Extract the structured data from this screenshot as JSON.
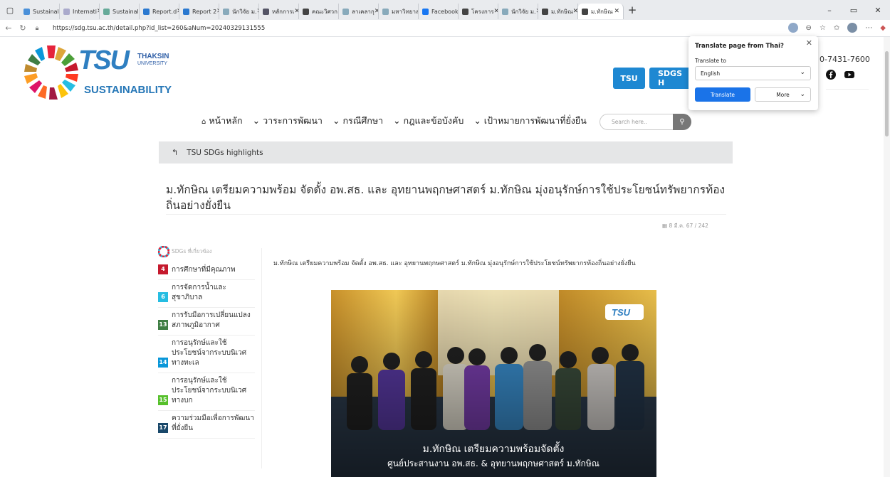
{
  "browser": {
    "tabs": [
      {
        "label": "Sustainal",
        "color": "#4a90d9"
      },
      {
        "label": "Internati",
        "color": "#aac"
      },
      {
        "label": "Sustainal",
        "color": "#6a9"
      },
      {
        "label": "Report.d",
        "color": "#2b79d0"
      },
      {
        "label": "Report 2",
        "color": "#2b79d0"
      },
      {
        "label": "นักวิจัย ม.",
        "color": "#8ab"
      },
      {
        "label": "หลักการเ",
        "color": "#556"
      },
      {
        "label": "คณะวิศวก",
        "color": "#444"
      },
      {
        "label": "ลาเคลากุ",
        "color": "#8ab"
      },
      {
        "label": "มหาวิทยาล",
        "color": "#8ab"
      },
      {
        "label": "Facebook",
        "color": "#1877f2"
      },
      {
        "label": "โครงการ",
        "color": "#444"
      },
      {
        "label": "นักวิจัย ม.",
        "color": "#8ab"
      },
      {
        "label": "ม.ทักษิณ",
        "color": "#444"
      },
      {
        "label": "ม.ทักษิณ",
        "color": "#444",
        "active": true
      }
    ],
    "url": "https://sdg.tsu.ac.th/detail.php?id_list=260&aNum=20240329131555"
  },
  "header": {
    "logo_text": "TSU",
    "uni_name_1": "THAKSIN",
    "uni_name_2": "UNIVERSITY",
    "logo_sub": "SUSTAINABILITY",
    "btn_tsu": "TSU",
    "btn_sdgs": "SDGS H",
    "phone": "0-7431-7600"
  },
  "nav": {
    "home": "หน้าหลัก",
    "item1": "วาระการพัฒนา",
    "item2": "กรณีศึกษา",
    "item3": "กฎและข้อบังคับ",
    "item4": "เป้าหมายการพัฒนาที่ยั่งยืน",
    "search_placeholder": "Search here.."
  },
  "breadcrumb": "TSU SDGs highlights",
  "article": {
    "title": "ม.ทักษิณ เตรียมความพร้อม จัดตั้ง อพ.สธ. และ อุทยานพฤกษศาสตร์ ม.ทักษิณ มุ่งอนุรักษ์การใช้ประโยชน์ทรัพยากรท้องถิ่นอย่างยั่งยืน",
    "meta": "8 มี.ค. 67 / 242",
    "lead": "ม.ทักษิณ เตรียมความพร้อม จัดตั้ง อพ.สธ. และ อุทยานพฤกษศาสตร์ ม.ทักษิณ มุ่งอนุรักษ์การใช้ประโยชน์ทรัพยากรท้องถิ่นอย่างยั่งยืน",
    "photo_caption_1": "ม.ทักษิณ เตรียมความพร้อมจัดตั้ง",
    "photo_caption_2": "ศูนย์ประสานงาน อพ.สธ. & อุทยานพฤกษศาสตร์ ม.ทักษิณ"
  },
  "sidebar": {
    "heading": "SDGs ที่เกี่ยวข้อง",
    "items": [
      {
        "num": "4",
        "label": "การศึกษาที่มีคุณภาพ",
        "color": "#c5192d"
      },
      {
        "num": "6",
        "label": "การจัดการน้ำและสุขาภิบาล",
        "color": "#26bde2"
      },
      {
        "num": "13",
        "label": "การรับมือการเปลี่ยนแปลงสภาพภูมิอากาศ",
        "color": "#3f7e44"
      },
      {
        "num": "14",
        "label": "การอนุรักษ์และใช้ประโยชน์จากระบบนิเวศทางทะเล",
        "color": "#0a97d9"
      },
      {
        "num": "15",
        "label": "การอนุรักษ์และใช้ประโยชน์จากระบบนิเวศทางบก",
        "color": "#56c02b"
      },
      {
        "num": "17",
        "label": "ความร่วมมือเพื่อการพัฒนาที่ยั่งยืน",
        "color": "#19486a"
      }
    ]
  },
  "translate_popup": {
    "title": "Translate page from Thai?",
    "label": "Translate to",
    "selected": "English",
    "translate": "Translate",
    "more": "More"
  }
}
